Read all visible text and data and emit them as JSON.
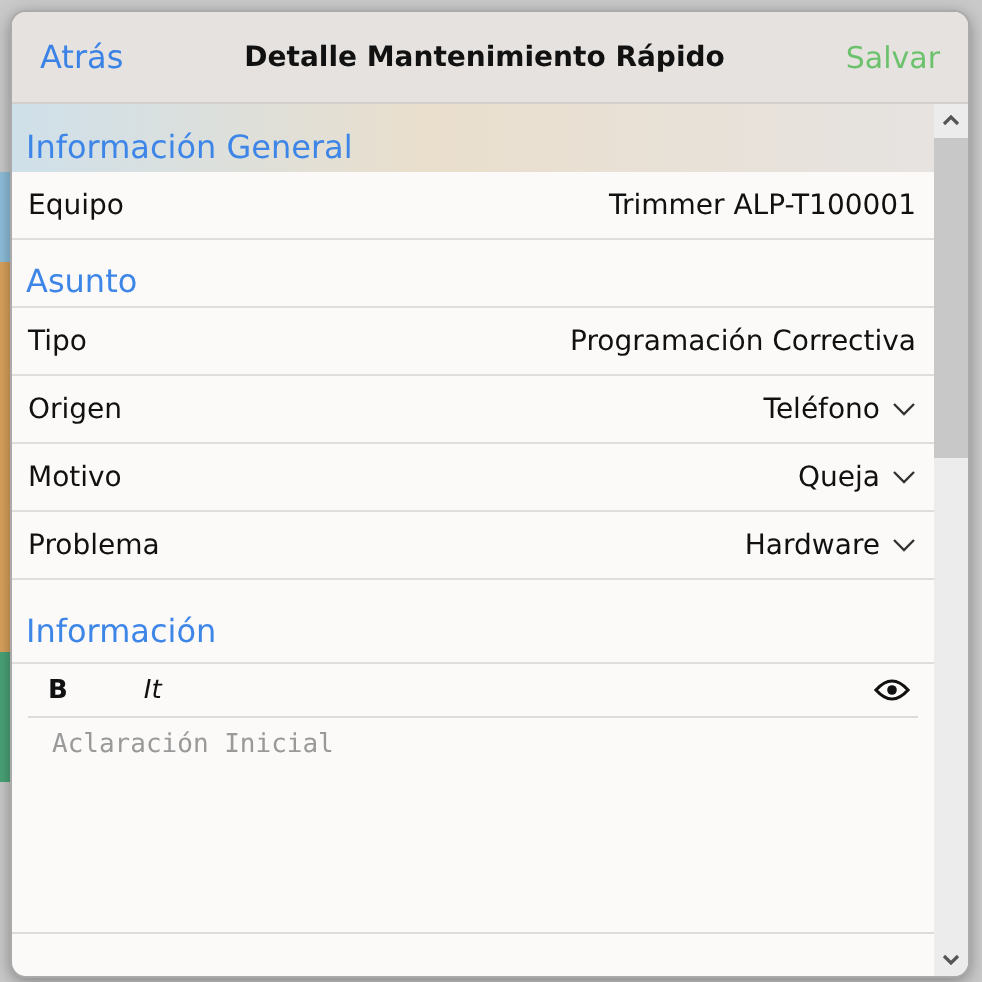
{
  "header": {
    "back": "Atrás",
    "title": "Detalle Mantenimiento Rápido",
    "save": "Salvar"
  },
  "sections": [
    {
      "title": "Información General",
      "rows": [
        {
          "label": "Equipo",
          "value": "Trimmer ALP-T100001",
          "kind": "text"
        }
      ]
    },
    {
      "title": "Asunto",
      "rows": [
        {
          "label": "Tipo",
          "value": "Programación Correctiva",
          "kind": "text"
        },
        {
          "label": "Origen",
          "value": "Teléfono",
          "kind": "picker"
        },
        {
          "label": "Motivo",
          "value": "Queja",
          "kind": "picker"
        },
        {
          "label": "Problema",
          "value": "Hardware",
          "kind": "picker"
        }
      ]
    }
  ],
  "info": {
    "title": "Información",
    "toolbar": [
      {
        "label": "B",
        "kind": "bold"
      },
      {
        "label": "It",
        "kind": "italic"
      }
    ],
    "placeholder": "Aclaración Inicial"
  }
}
